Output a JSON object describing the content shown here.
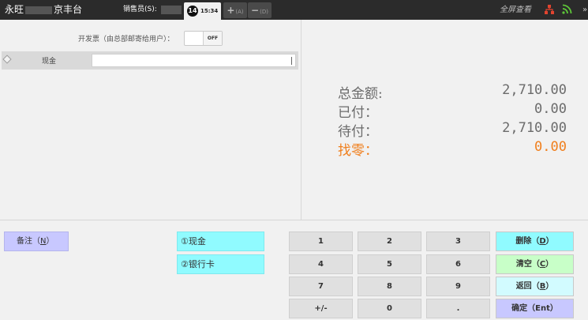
{
  "topbar": {
    "store_prefix": "永旺",
    "store_suffix": "京丰台",
    "seller_label": "销售员(S):",
    "order_count": "14",
    "time": "15:34",
    "add_hotkey": "(A)",
    "remove_hotkey": "(D)",
    "fullscreen_label": "全屏查看",
    "more_label": "»"
  },
  "invoice": {
    "label": "开发票（由总部邮寄给用户）：",
    "toggle_state": "OFF"
  },
  "payment_rows": [
    {
      "label": "现金",
      "amount": ""
    }
  ],
  "totals": {
    "total_label": "总金额:",
    "total_value": "2,710.00",
    "paid_label": "已付：",
    "paid_value": "0.00",
    "pending_label": "待付：",
    "pending_value": "2,710.00",
    "change_label": "找零：",
    "change_value": "0.00"
  },
  "remark": {
    "label": "备注",
    "hotkey": "N"
  },
  "pay_methods": [
    {
      "label": "①现金"
    },
    {
      "label": "②银行卡"
    }
  ],
  "keypad": [
    "1",
    "2",
    "3",
    "4",
    "5",
    "6",
    "7",
    "8",
    "9",
    "+/-",
    "0",
    "."
  ],
  "functions": {
    "delete_label": "删除",
    "delete_key": "D",
    "clear_label": "清空",
    "clear_key": "C",
    "back_label": "返回",
    "back_key": "B",
    "confirm_label": "确定（Ent）"
  },
  "colors": {
    "topbar_bg": "#2b2b2b",
    "change_accent": "#f07f1d",
    "paymethod_bg": "#90fbff",
    "remark_bg": "#c8c8ff",
    "delete_bg": "#90fbff",
    "clear_bg": "#c8ffc8",
    "back_bg": "#d2fbff",
    "confirm_bg": "#c8c8ff"
  }
}
